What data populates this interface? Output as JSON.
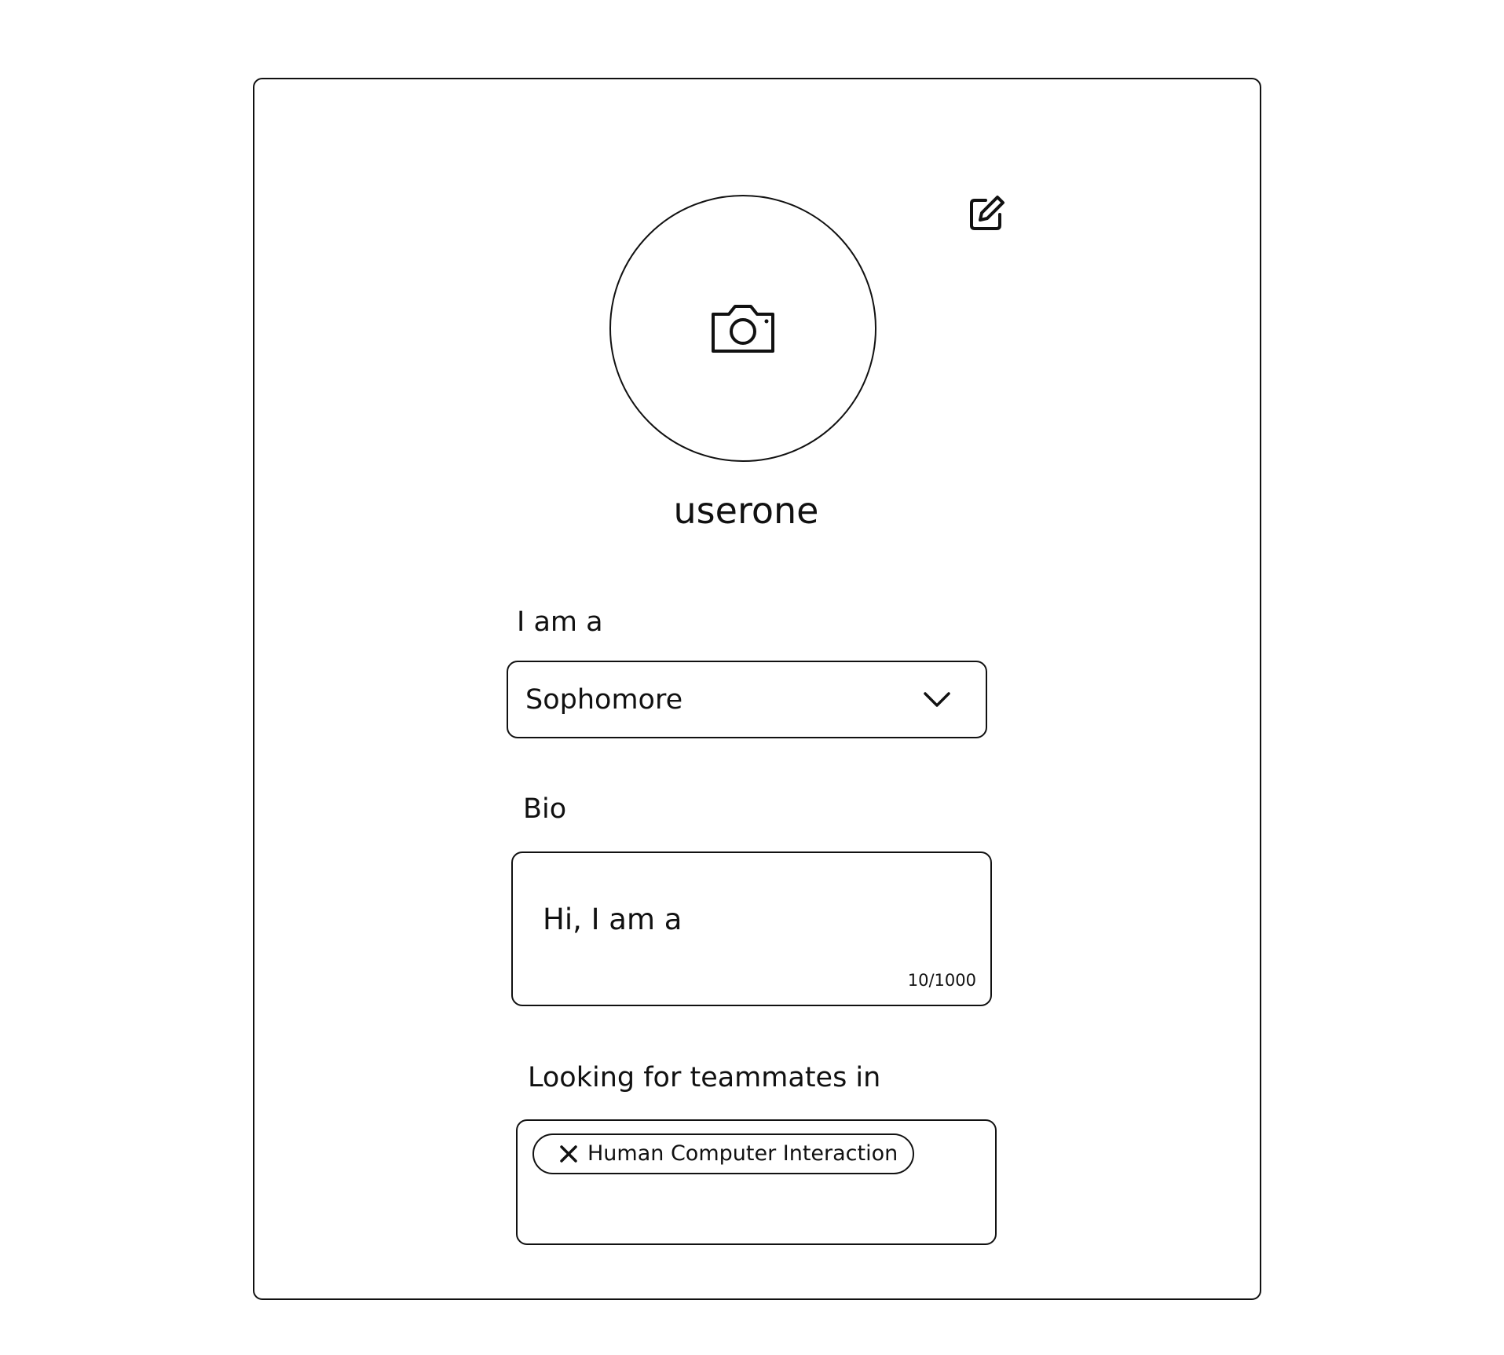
{
  "profile": {
    "username": "userone",
    "avatar_icon": "camera-icon",
    "edit_icon": "edit-icon"
  },
  "role": {
    "label": "I am a",
    "selected": "Sophomore",
    "dropdown_icon": "chevron-down-icon"
  },
  "bio": {
    "label": "Bio",
    "value": "Hi, I am a",
    "counter": "10/1000"
  },
  "teammates": {
    "label": "Looking for teammates in",
    "tags": [
      {
        "label": "Human Computer Interaction",
        "remove_icon": "close-icon"
      }
    ]
  }
}
